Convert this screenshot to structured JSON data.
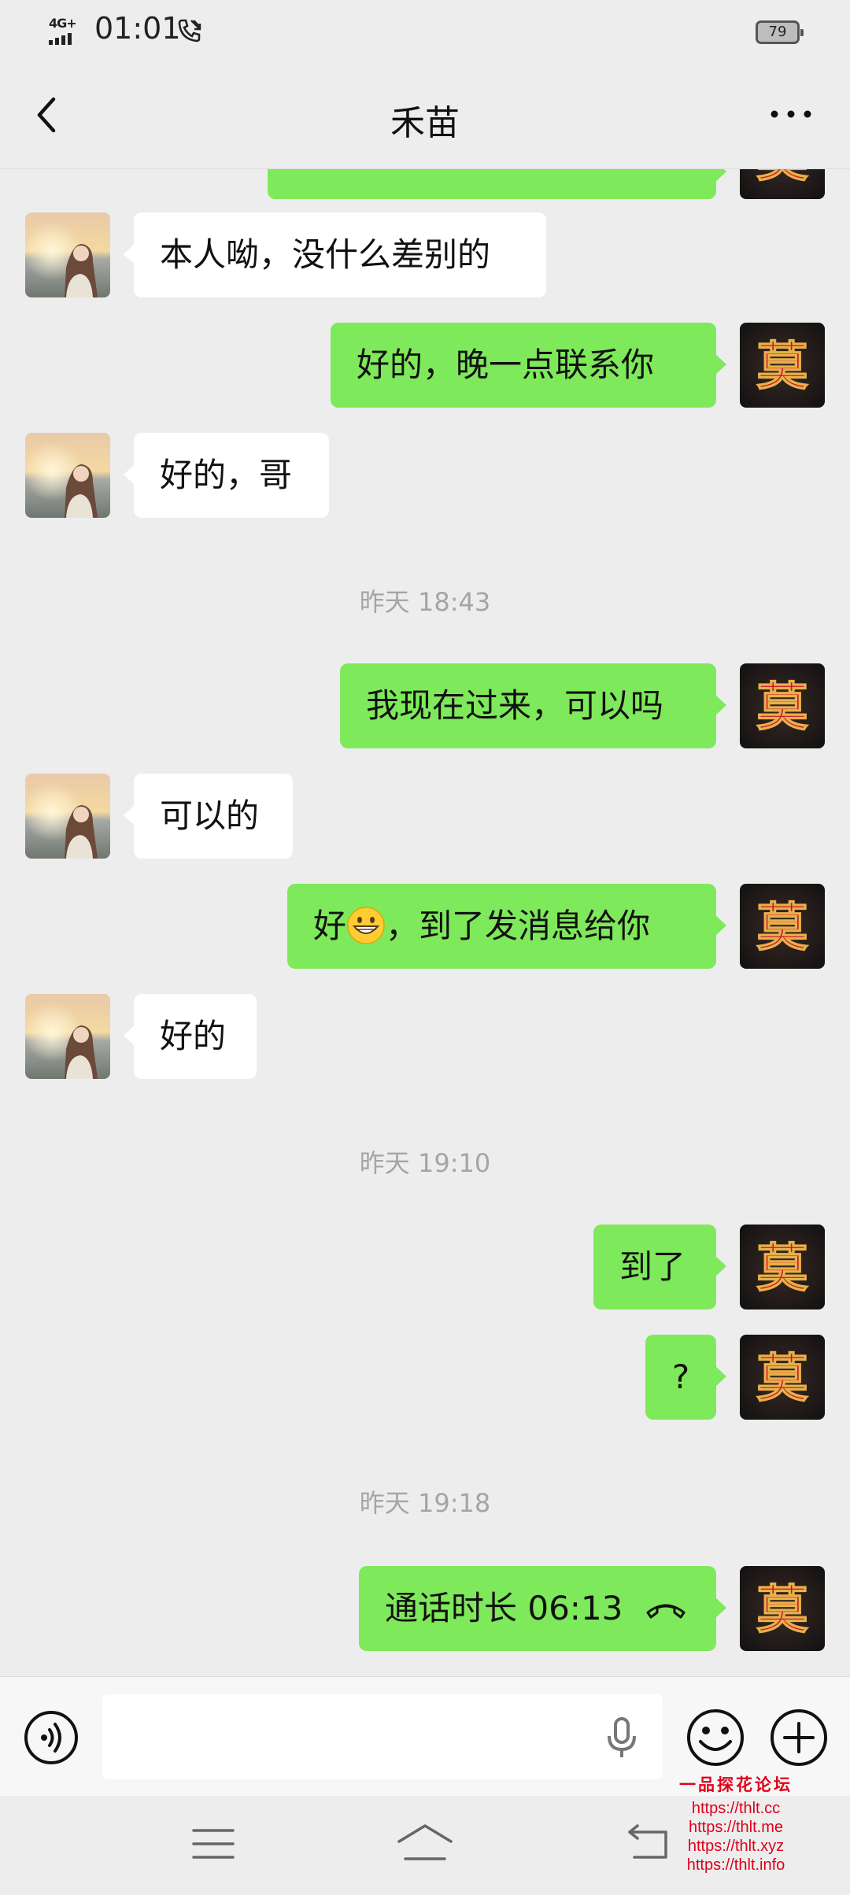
{
  "status_bar": {
    "network": "4G+",
    "time": "01:01",
    "battery": "79"
  },
  "header": {
    "title": "禾苗"
  },
  "messages": [
    {
      "side": "out",
      "text": ""
    },
    {
      "side": "in",
      "text": "本人呦，没什么差别的"
    },
    {
      "side": "out",
      "text": "好的，晚一点联系你"
    },
    {
      "side": "in",
      "text": "好的，哥"
    },
    {
      "side": "time",
      "text": "昨天 18:43"
    },
    {
      "side": "out",
      "text": "我现在过来，可以吗"
    },
    {
      "side": "in",
      "text": "可以的"
    },
    {
      "side": "out",
      "text_before": "好",
      "emoji": "grinning-face-emoji",
      "text_after": "，到了发消息给你"
    },
    {
      "side": "in",
      "text": "好的"
    },
    {
      "side": "time",
      "text": "昨天 19:10"
    },
    {
      "side": "out",
      "text": "到了"
    },
    {
      "side": "out",
      "text": "?"
    },
    {
      "side": "time",
      "text": "昨天 19:18"
    },
    {
      "side": "out",
      "text": "通话时长 06:13"
    }
  ],
  "input_bar": {
    "placeholder": ""
  },
  "watermark": {
    "title": "一品探花论坛",
    "links": [
      "https://thlt.cc",
      "https://thlt.me",
      "https://thlt.xyz",
      "https://thlt.info"
    ]
  },
  "colors": {
    "background": "#ededed",
    "outgoing_bubble": "#7ee95a",
    "incoming_bubble": "#ffffff",
    "timestamp": "#a5a5a5",
    "watermark": "#e0001a"
  },
  "icons": [
    "back-icon",
    "more-icon",
    "voice-icon",
    "mic-icon",
    "emoji-icon",
    "plus-icon",
    "menu-key-icon",
    "home-key-icon",
    "back-key-icon",
    "phone-call-icon",
    "hang-up-icon"
  ]
}
